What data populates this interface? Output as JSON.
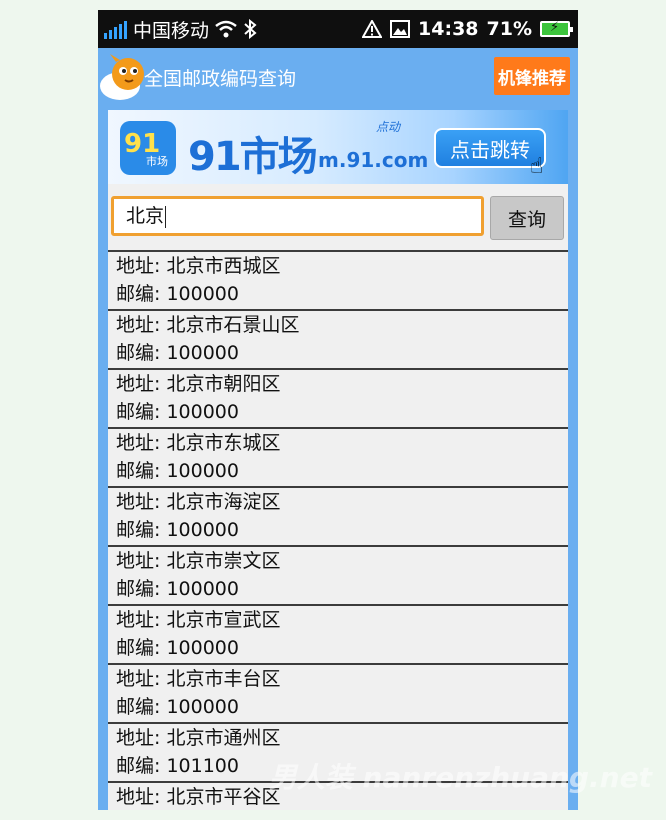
{
  "status_bar": {
    "carrier": "中国移动",
    "time": "14:38",
    "battery": "71%",
    "icons": [
      "signal-icon",
      "wifi-icon",
      "bluetooth-icon",
      "warning-icon",
      "image-icon",
      "battery-icon"
    ]
  },
  "header": {
    "title": "全国邮政编码查询",
    "recommend_label": "机锋推荐"
  },
  "ad": {
    "logo_text": "91",
    "logo_sub": "市场",
    "brand": "91市场",
    "domain": "m.91.com",
    "tag": "点动",
    "button_label": "点击跳转"
  },
  "search": {
    "value": "北京",
    "button_label": "查询"
  },
  "results": [
    {
      "address": "地址: 北京市西城区",
      "postcode": "邮编: 100000"
    },
    {
      "address": "地址: 北京市石景山区",
      "postcode": "邮编: 100000"
    },
    {
      "address": "地址: 北京市朝阳区",
      "postcode": "邮编: 100000"
    },
    {
      "address": "地址: 北京市东城区",
      "postcode": "邮编: 100000"
    },
    {
      "address": "地址: 北京市海淀区",
      "postcode": "邮编: 100000"
    },
    {
      "address": "地址: 北京市崇文区",
      "postcode": "邮编: 100000"
    },
    {
      "address": "地址: 北京市宣武区",
      "postcode": "邮编: 100000"
    },
    {
      "address": "地址: 北京市丰台区",
      "postcode": "邮编: 100000"
    },
    {
      "address": "地址: 北京市通州区",
      "postcode": "邮编: 101100"
    },
    {
      "address": "地址: 北京市平谷区",
      "postcode": ""
    }
  ],
  "watermark": "男人装 nanrenzhuang.net",
  "colors": {
    "header_bg": "#6aaef0",
    "accent_orange": "#ff7a1a",
    "input_border": "#f0a030",
    "list_bg": "#f0f0f0"
  }
}
